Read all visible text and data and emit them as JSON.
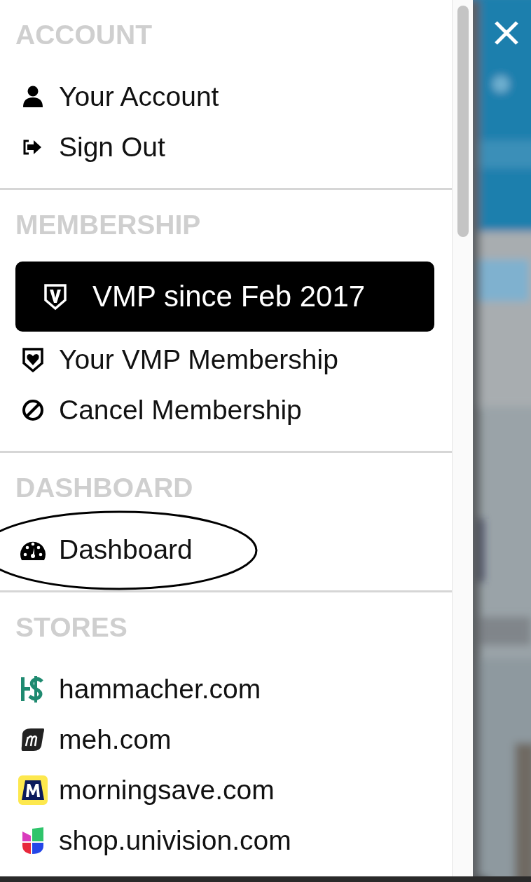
{
  "sections": [
    {
      "heading": "ACCOUNT",
      "items": [
        {
          "kind": "link",
          "label": "Your Account",
          "circled": false
        },
        {
          "kind": "link",
          "label": "Sign Out",
          "circled": false
        }
      ]
    },
    {
      "heading": "MEMBERSHIP",
      "items": [
        {
          "kind": "badge",
          "label": "VMP since Feb 2017",
          "circled": false
        },
        {
          "kind": "link",
          "label": "Your VMP Membership",
          "circled": false
        },
        {
          "kind": "link",
          "label": "Cancel Membership",
          "circled": false
        }
      ]
    },
    {
      "heading": "DASHBOARD",
      "items": [
        {
          "kind": "link",
          "label": "Dashboard",
          "circled": true
        }
      ]
    },
    {
      "heading": "STORES",
      "items": [
        {
          "kind": "link",
          "label": "hammacher.com",
          "circled": false
        },
        {
          "kind": "link",
          "label": "meh.com",
          "circled": false
        },
        {
          "kind": "link",
          "label": "morningsave.com",
          "circled": false
        },
        {
          "kind": "link",
          "label": "shop.univision.com",
          "circled": false
        }
      ]
    }
  ]
}
